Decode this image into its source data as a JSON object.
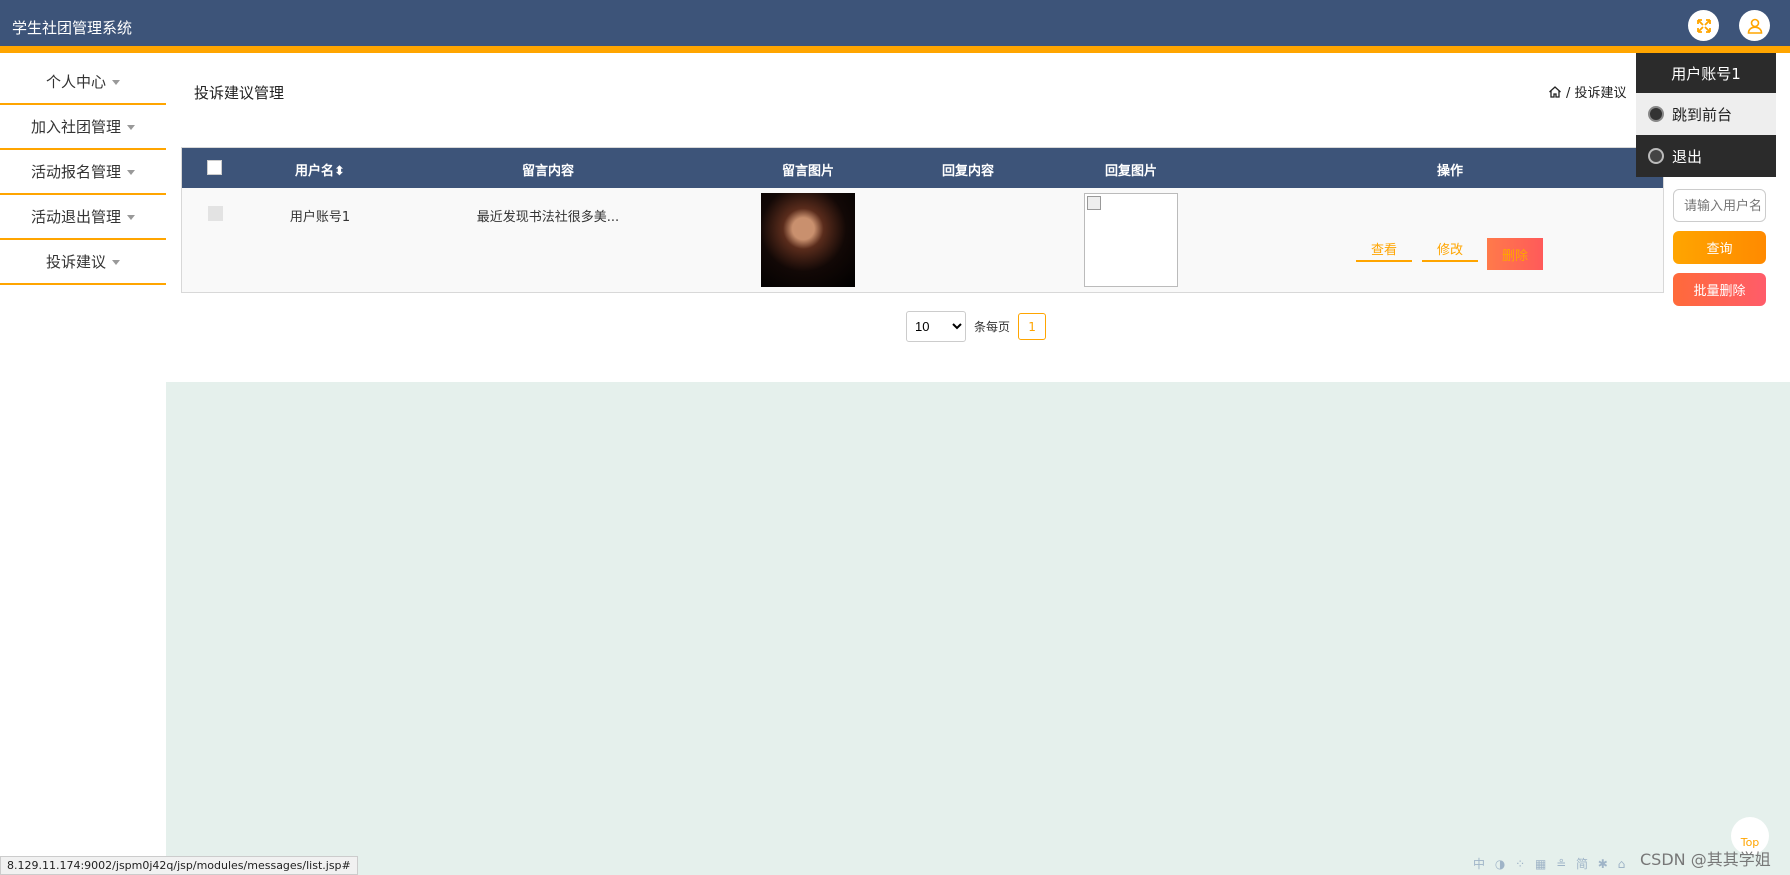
{
  "app": {
    "title": "学生社团管理系统"
  },
  "header": {
    "fullscreen_icon": "fullscreen-icon",
    "user_icon": "user-icon"
  },
  "sidebar": {
    "items": [
      {
        "label": "个人中心"
      },
      {
        "label": "加入社团管理"
      },
      {
        "label": "活动报名管理"
      },
      {
        "label": "活动退出管理"
      },
      {
        "label": "投诉建议"
      }
    ]
  },
  "main": {
    "page_title": "投诉建议管理",
    "breadcrumb": "/ 投诉建议"
  },
  "table": {
    "headers": [
      "用户名",
      "留言内容",
      "留言图片",
      "回复内容",
      "回复图片",
      "操作"
    ],
    "sort_indicator": "⬍",
    "rows": [
      {
        "username": "用户账号1",
        "content": "最近发现书法社很多美...",
        "reply": "",
        "actions": {
          "view": "查看",
          "edit": "修改",
          "delete": "删除"
        }
      }
    ]
  },
  "pagination": {
    "page_size": "10",
    "page_size_options": [
      "10"
    ],
    "per_page_label": "条每页",
    "current_page": "1"
  },
  "search": {
    "placeholder": "请输入用户名",
    "query_button": "查询",
    "batch_delete_button": "批量删除"
  },
  "user_menu": {
    "account": "用户账号1",
    "items": [
      {
        "label": "跳到前台"
      },
      {
        "label": "退出"
      }
    ]
  },
  "misc": {
    "top_button": "Top",
    "status_url": "8.129.11.174:9002/jspm0j42q/jsp/modules/messages/list.jsp#",
    "tray_text": "中 ◑ ⁘ ▦ ≗ 简 ✱ ⌂",
    "watermark": "CSDN @其其学姐"
  },
  "colors": {
    "header": "#3d5479",
    "accent": "#ffa500",
    "danger": "#ff5a5a",
    "content_bg": "#e5f0ec"
  }
}
